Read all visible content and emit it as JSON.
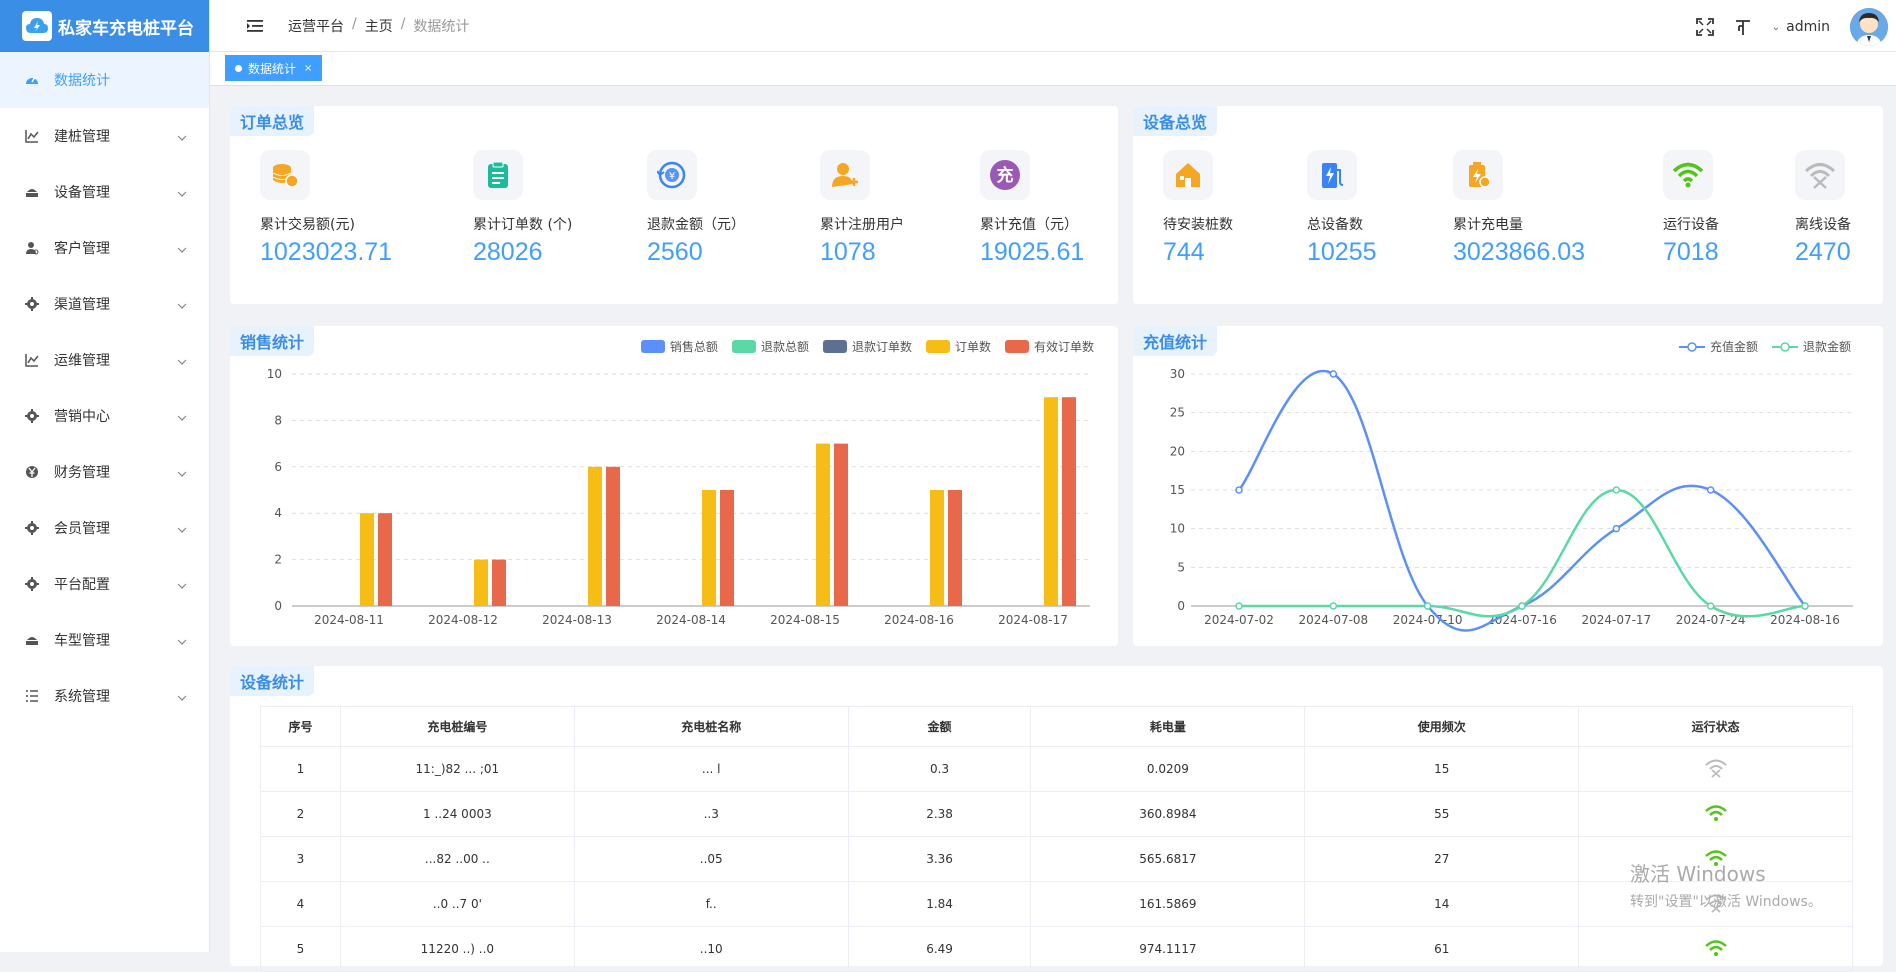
{
  "app": {
    "title": "私家车充电桩平台"
  },
  "sidebar": {
    "items": [
      {
        "label": "数据统计",
        "icon": "dashboard-icon",
        "active": true
      },
      {
        "label": "建桩管理",
        "icon": "chart-line-icon"
      },
      {
        "label": "设备管理",
        "icon": "device-icon"
      },
      {
        "label": "客户管理",
        "icon": "user-icon"
      },
      {
        "label": "渠道管理",
        "icon": "gear-icon"
      },
      {
        "label": "运维管理",
        "icon": "chart-line-icon"
      },
      {
        "label": "营销中心",
        "icon": "gear-icon"
      },
      {
        "label": "财务管理",
        "icon": "yen-icon"
      },
      {
        "label": "会员管理",
        "icon": "gear-icon"
      },
      {
        "label": "平台配置",
        "icon": "gear-icon"
      },
      {
        "label": "车型管理",
        "icon": "device-icon"
      },
      {
        "label": "系统管理",
        "icon": "list-icon"
      }
    ]
  },
  "header": {
    "breadcrumbs": [
      "运营平台",
      "主页",
      "数据统计"
    ],
    "user": "admin"
  },
  "tabs": [
    {
      "label": "数据统计"
    }
  ],
  "order_overview": {
    "title": "订单总览",
    "stats": [
      {
        "label": "累计交易额(元)",
        "value": "1023023.71",
        "icon": "coins-icon",
        "color": "#f5a623"
      },
      {
        "label": "累计订单数 (个)",
        "value": "28026",
        "icon": "clipboard-icon",
        "color": "#1abc9c"
      },
      {
        "label": "退款金额（元）",
        "value": "2560",
        "icon": "refund-icon",
        "color": "#3b82f6"
      },
      {
        "label": "累计注册用户",
        "value": "1078",
        "icon": "user-add-icon",
        "color": "#f5a623"
      },
      {
        "label": "累计充值（元）",
        "value": "19025.61",
        "icon": "recharge-icon",
        "color": "#9b59b6",
        "glyph": "充"
      }
    ]
  },
  "device_overview": {
    "title": "设备总览",
    "stats": [
      {
        "label": "待安装桩数",
        "value": "744",
        "icon": "house-icon",
        "color": "#f5a623"
      },
      {
        "label": "总设备数",
        "value": "10255",
        "icon": "charger-icon",
        "color": "#3b82f6"
      },
      {
        "label": "累计充电量",
        "value": "3023866.03",
        "icon": "battery-icon",
        "color": "#f5a623"
      },
      {
        "label": "运行设备",
        "value": "7018",
        "icon": "wifi-icon",
        "color": "#52c41a"
      },
      {
        "label": "离线设备",
        "value": "2470",
        "icon": "wifi-off-icon",
        "color": "#bbbbbb"
      }
    ]
  },
  "sales_chart": {
    "title": "销售统计",
    "chart_data": {
      "type": "bar",
      "categories": [
        "2024-08-11",
        "2024-08-12",
        "2024-08-13",
        "2024-08-14",
        "2024-08-15",
        "2024-08-16",
        "2024-08-17"
      ],
      "series": [
        {
          "name": "销售总额",
          "color": "#5b8ff9",
          "values": [
            0,
            0,
            0,
            0,
            0,
            0,
            0
          ]
        },
        {
          "name": "退款总额",
          "color": "#5ad8a6",
          "values": [
            0,
            0,
            0,
            0,
            0,
            0,
            0
          ]
        },
        {
          "name": "退款订单数",
          "color": "#5d7092",
          "values": [
            0,
            0,
            0,
            0,
            0,
            0,
            0
          ]
        },
        {
          "name": "订单数",
          "color": "#f6bd16",
          "values": [
            4,
            2,
            6,
            5,
            7,
            5,
            9
          ]
        },
        {
          "name": "有效订单数",
          "color": "#e8684a",
          "values": [
            4,
            2,
            6,
            5,
            7,
            5,
            9
          ]
        }
      ],
      "ylim": [
        0,
        10
      ],
      "yticks": [
        "0",
        "2",
        "4",
        "6",
        "8",
        "10"
      ],
      "grid": true,
      "legend": "top-right"
    }
  },
  "recharge_chart": {
    "title": "充值统计",
    "chart_data": {
      "type": "line",
      "categories": [
        "2024-07-02",
        "2024-07-08",
        "2024-07-10",
        "2024-07-16",
        "2024-07-17",
        "2024-07-24",
        "2024-08-16"
      ],
      "series": [
        {
          "name": "充值金额",
          "color": "#5b8ff9",
          "values": [
            15,
            30,
            0,
            0,
            10,
            15,
            0
          ]
        },
        {
          "name": "退款金额",
          "color": "#5ad8a6",
          "values": [
            0,
            0,
            0,
            0,
            15,
            0,
            0
          ]
        }
      ],
      "ylim": [
        0,
        30
      ],
      "yticks": [
        "0",
        "5",
        "10",
        "15",
        "20",
        "25",
        "30"
      ],
      "smooth": true,
      "grid": true,
      "legend": "top-right"
    }
  },
  "device_table": {
    "title": "设备统计",
    "columns": [
      "序号",
      "充电桩编号",
      "充电桩名称",
      "金额",
      "耗电量",
      "使用频次",
      "运行状态"
    ],
    "rows": [
      {
        "index": "1",
        "code": "11:_)82 ... ;01",
        "name": "... l",
        "amount": "0.3",
        "power": "0.0209",
        "freq": "15",
        "status": "offline"
      },
      {
        "index": "2",
        "code": "1 ..24 0003",
        "name": "..3",
        "amount": "2.38",
        "power": "360.8984",
        "freq": "55",
        "status": "online"
      },
      {
        "index": "3",
        "code": "...82 ..00 ..",
        "name": "..05",
        "amount": "3.36",
        "power": "565.6817",
        "freq": "27",
        "status": "online"
      },
      {
        "index": "4",
        "code": "..0 ..7 0'",
        "name": "f..",
        "amount": "1.84",
        "power": "161.5869",
        "freq": "14",
        "status": "offline"
      },
      {
        "index": "5",
        "code": "11220 ..) ..0",
        "name": "..10",
        "amount": "6.49",
        "power": "974.1117",
        "freq": "61",
        "status": "online"
      }
    ]
  },
  "watermark": {
    "line1": "激活 Windows",
    "line2": "转到\"设置\"以激活 Windows。"
  }
}
